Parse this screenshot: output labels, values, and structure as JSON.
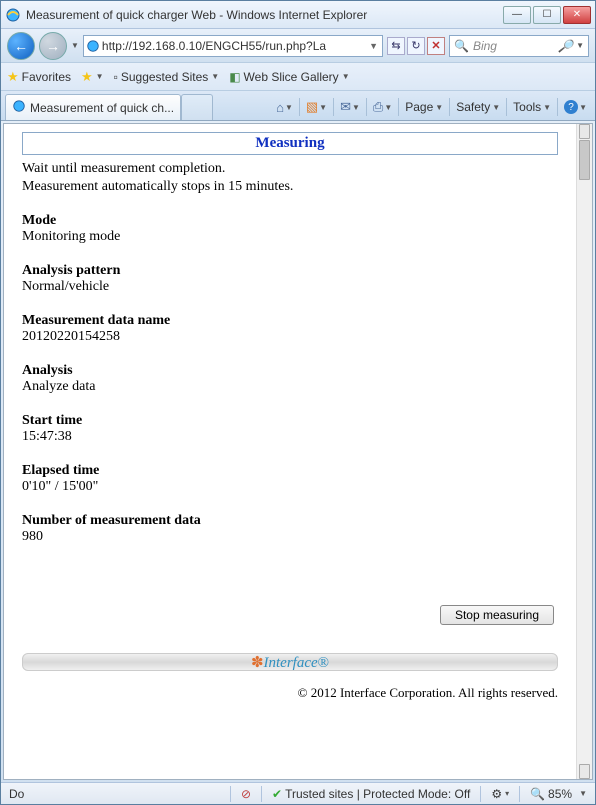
{
  "window": {
    "title": "Measurement of quick charger Web - Windows Internet Explorer",
    "url": "http://192.168.0.10/ENGCH55/run.php?La",
    "search_placeholder": "Bing"
  },
  "favbar": {
    "favorites": "Favorites",
    "suggested": "Suggested Sites",
    "webslice": "Web Slice Gallery"
  },
  "tab": {
    "title": "Measurement of quick ch..."
  },
  "cmdbar": {
    "page": "Page",
    "safety": "Safety",
    "tools": "Tools"
  },
  "content": {
    "heading": "Measuring",
    "msg1": "Wait until measurement completion.",
    "msg2": "Measurement automatically stops in 15 minutes.",
    "mode_label": "Mode",
    "mode_value": "Monitoring mode",
    "pattern_label": "Analysis pattern",
    "pattern_value": "Normal/vehicle",
    "dataname_label": "Measurement data name",
    "dataname_value": "20120220154258",
    "analysis_label": "Analysis",
    "analysis_value": "Analyze data",
    "start_label": "Start time",
    "start_value": "15:47:38",
    "elapsed_label": "Elapsed time",
    "elapsed_value": "0'10\" / 15'00\"",
    "count_label": "Number of measurement data",
    "count_value": "980",
    "stop_label": "Stop measuring",
    "logo_text": "Interface",
    "copyright": "© 2012 Interface Corporation. All rights reserved."
  },
  "statusbar": {
    "left": "Do",
    "zone": "Trusted sites | Protected Mode: Off",
    "zoom": "85%"
  }
}
